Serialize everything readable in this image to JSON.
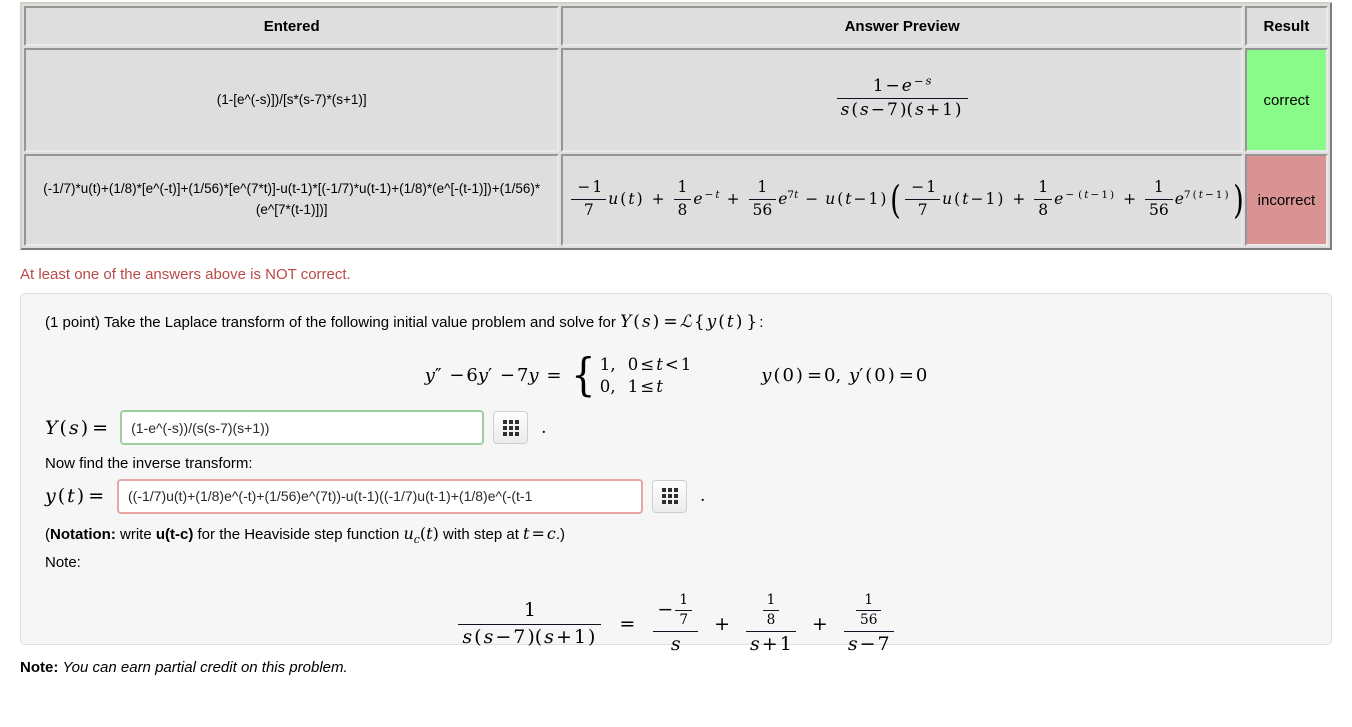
{
  "results_table": {
    "headers": [
      "Entered",
      "Answer Preview",
      "Result"
    ],
    "rows": [
      {
        "entered": "(1-[e^(-s)])/[s*(s-7)*(s+1)]",
        "preview_text": "(1 - e^(-s)) / (s(s - 7)(s + 1))",
        "result": "correct",
        "result_color": "#88fb88"
      },
      {
        "entered": "(-1/7)*u(t)+(1/8)*[e^(-t)]+(1/56)*[e^(7*t)]-u(t-1)*[(-1/7)*u(t-1)+(1/8)*(e^[-(t-1)])+(1/56)*(e^[7*(t-1)])]",
        "preview_text": "(-1/7)u(t) + (1/8)e^(-t) + (1/56)e^(7t) - u(t-1)((-1/7)u(t-1) + (1/8)e^(-(t-1)) + (1/56)e^(7(t-1)))",
        "result": "incorrect",
        "result_color": "#d99393"
      }
    ]
  },
  "warning": {
    "text": "At least one of the answers above is NOT correct.",
    "color": "#b94a48"
  },
  "problem": {
    "points_label": "(1 point)",
    "statement_before": "Take the Laplace transform of the following initial value problem and solve for",
    "statement_math": "Y(s) = L{y(t)}",
    "statement_after": ":",
    "ode": {
      "lhs": "y'' - 6y' - 7y =",
      "case1_value": "1,",
      "case1_cond": "0 ≤ t < 1",
      "case2_value": "0,",
      "case2_cond": "1 ≤ t",
      "initial_conditions": "y(0) = 0, y'(0) = 0"
    },
    "answer1": {
      "label": "Y(s) =",
      "value": "(1-e^(-s))/(s(s-7)(s+1))",
      "state": "correct",
      "border_color": "#9ccf9c",
      "button_icon": "grid-icon",
      "trailing": "."
    },
    "prompt_inverse": "Now find the inverse transform:",
    "answer2": {
      "label": "y(t) =",
      "value": "((-1/7)u(t)+(1/8)e^(-t)+(1/56)e^(7t))-u(t-1)((-1/7)u(t-1)+(1/8)e^(-(t-1",
      "state": "incorrect",
      "border_color": "#e8a6a6",
      "button_icon": "grid-icon",
      "trailing": "."
    },
    "notation": {
      "open": "(",
      "bold_label": "Notation:",
      "mid1": "write",
      "bold_fn": "u(t-c)",
      "mid2": "for the Heaviside step function",
      "math_uc": "u_c(t)",
      "mid3": "with step at",
      "math_tc": "t = c",
      "close": ".)"
    },
    "note_label": "Note:",
    "note_equation": "1/(s(s-7)(s+1)) = (-1/7)/s + (1/8)/(s+1) + (1/56)/(s-7)",
    "note_eq_parts": {
      "lhs_num": "1",
      "lhs_den": "s(s - 7)(s + 1)",
      "equals": "=",
      "t1_num": "-1/7",
      "t1_den": "s",
      "plus1": "+",
      "t2_num": "1/8",
      "t2_den": "s + 1",
      "plus2": "+",
      "t3_num": "1/56",
      "t3_den": "s - 7"
    }
  },
  "footer": {
    "note_label": "Note:",
    "note_text": "You can earn partial credit on this problem."
  }
}
